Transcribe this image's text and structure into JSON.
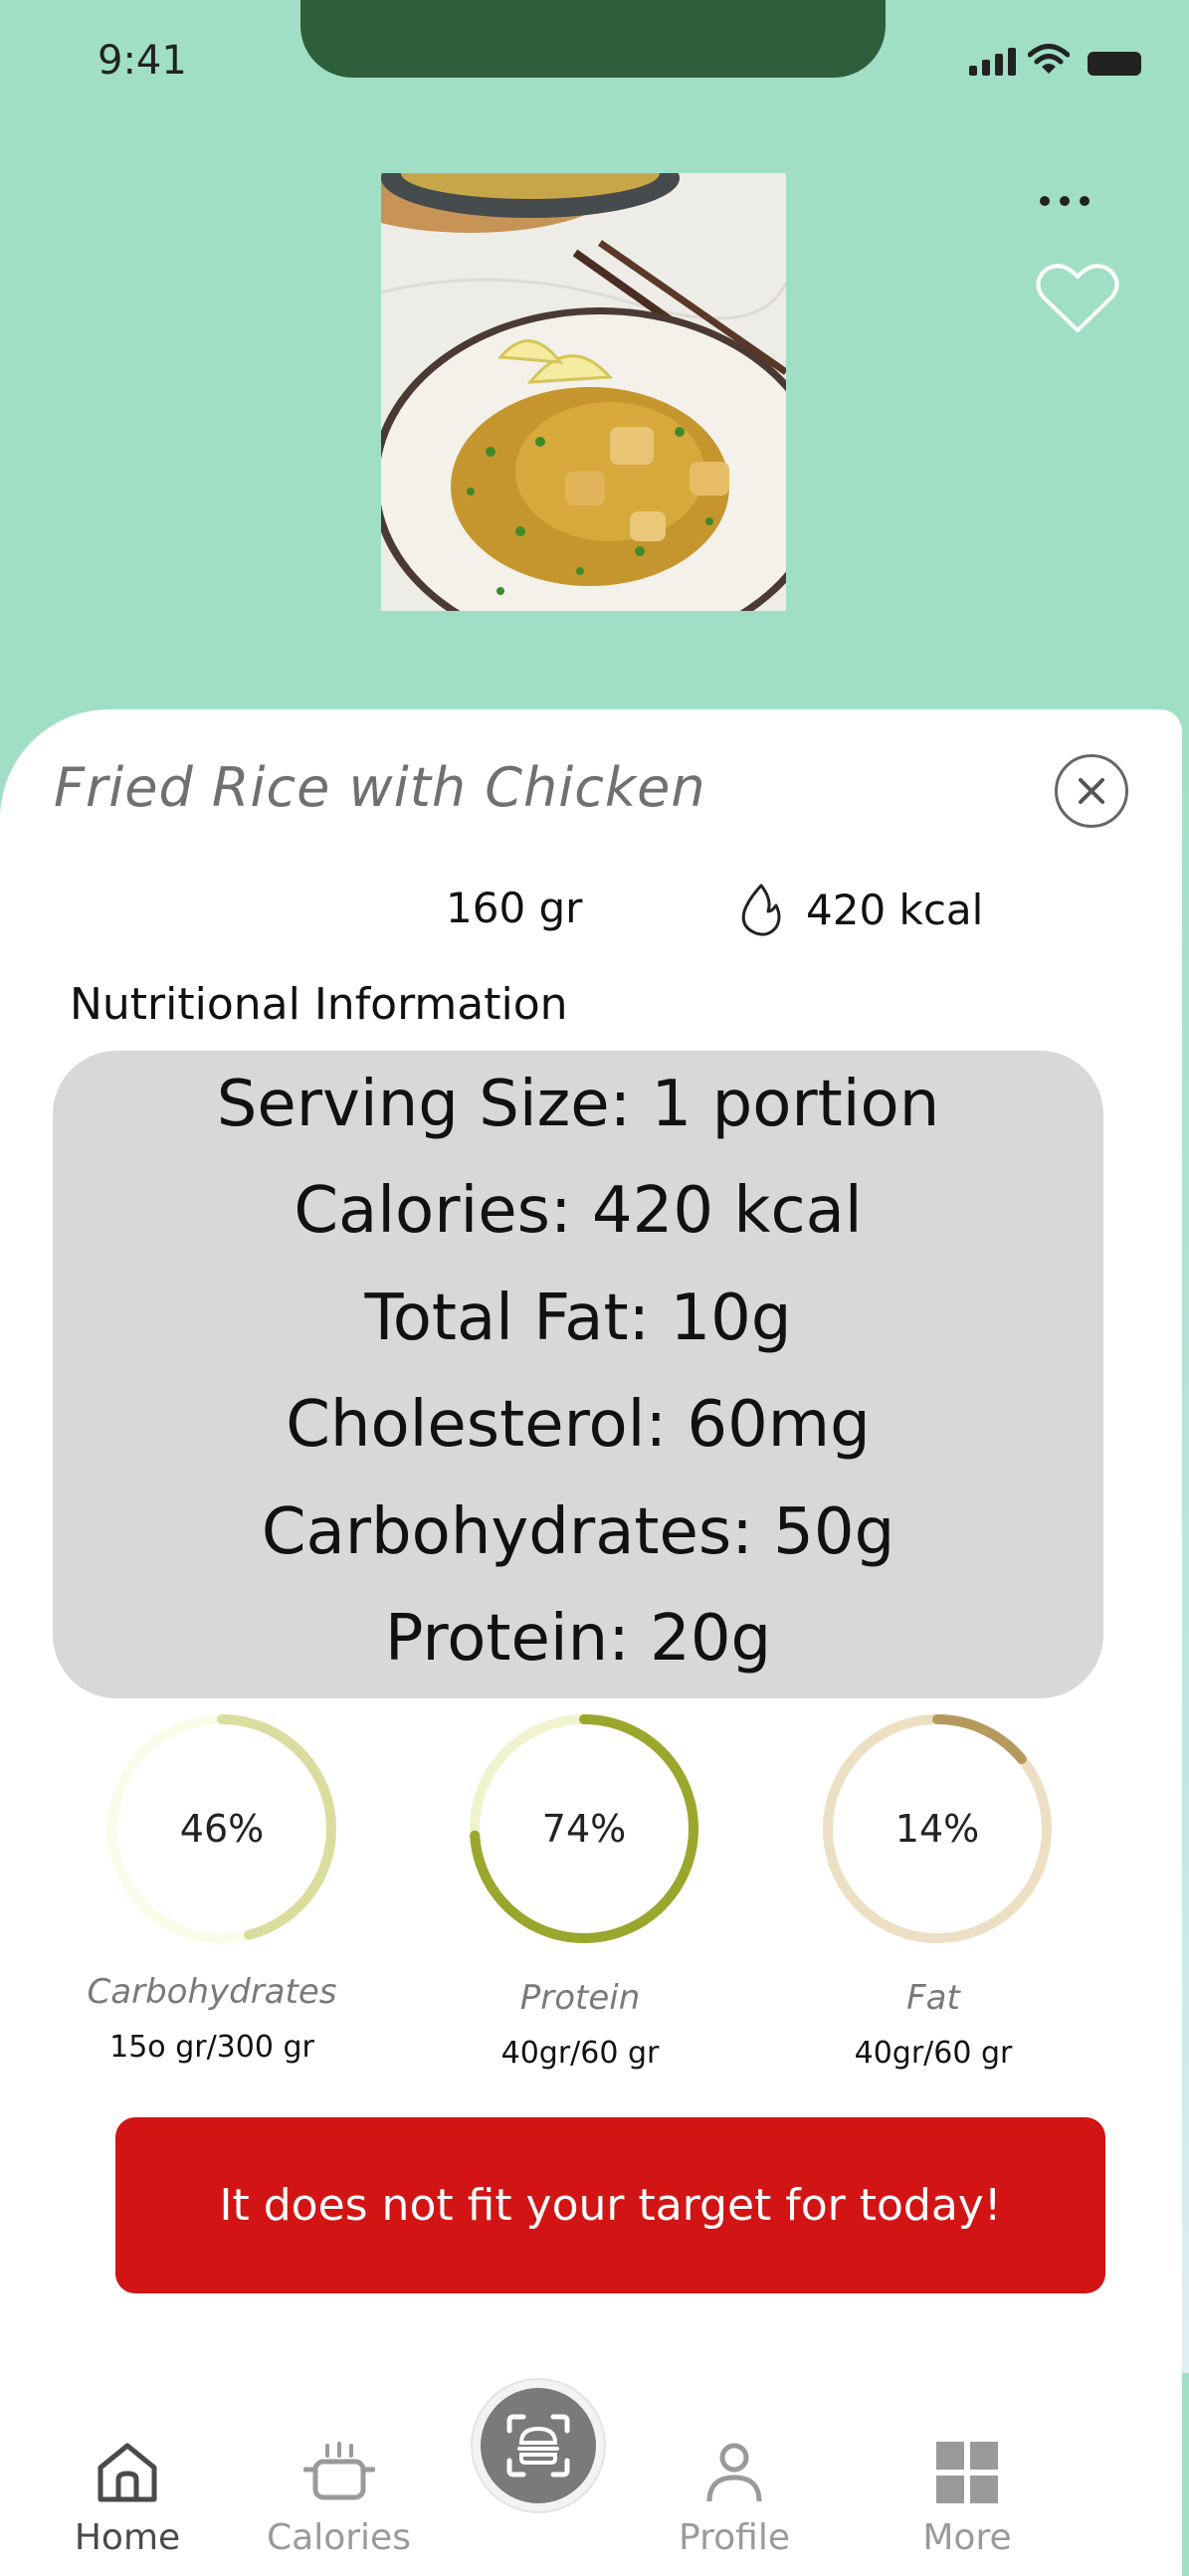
{
  "status_bar": {
    "time": "9:41"
  },
  "food": {
    "name": "Fried Rice with Chicken",
    "weight": "160 gr",
    "calories": "420 kcal"
  },
  "nutrition": {
    "heading": "Nutritional Information",
    "lines": [
      "Serving Size: 1 portion",
      "Calories: 420 kcal",
      "Total Fat: 10g",
      "Cholesterol: 60mg",
      "Carbohydrates: 50g",
      "Protein: 20g"
    ]
  },
  "macros": [
    {
      "name": "Carbohydrates",
      "percent_label": "46%",
      "percent": 46,
      "amount": "15o gr/300 gr",
      "color": "#dadd9d",
      "track": "#fbfbe9"
    },
    {
      "name": "Protein",
      "percent_label": "74%",
      "percent": 74,
      "amount": "40gr/60 gr",
      "color": "#9ba72c",
      "track": "#f1f3cf"
    },
    {
      "name": "Fat",
      "percent_label": "14%",
      "percent": 14,
      "amount": "40gr/60 gr",
      "color": "#b59a5e",
      "track": "#ecdfc3"
    }
  ],
  "warning": {
    "text": "It does not fit your target for today!",
    "color": "#d21414"
  },
  "tab_bar": {
    "home": "Home",
    "calories": "Calories",
    "profile": "Profile",
    "more": "More"
  },
  "colors": {
    "header_bg": "#a0dfc6",
    "notch": "#2f5f3a"
  },
  "icons": [
    "more-dots-icon",
    "heart-icon",
    "close-icon",
    "flame-icon",
    "home-icon",
    "pot-icon",
    "scan-icon",
    "person-icon",
    "grid-icon"
  ]
}
